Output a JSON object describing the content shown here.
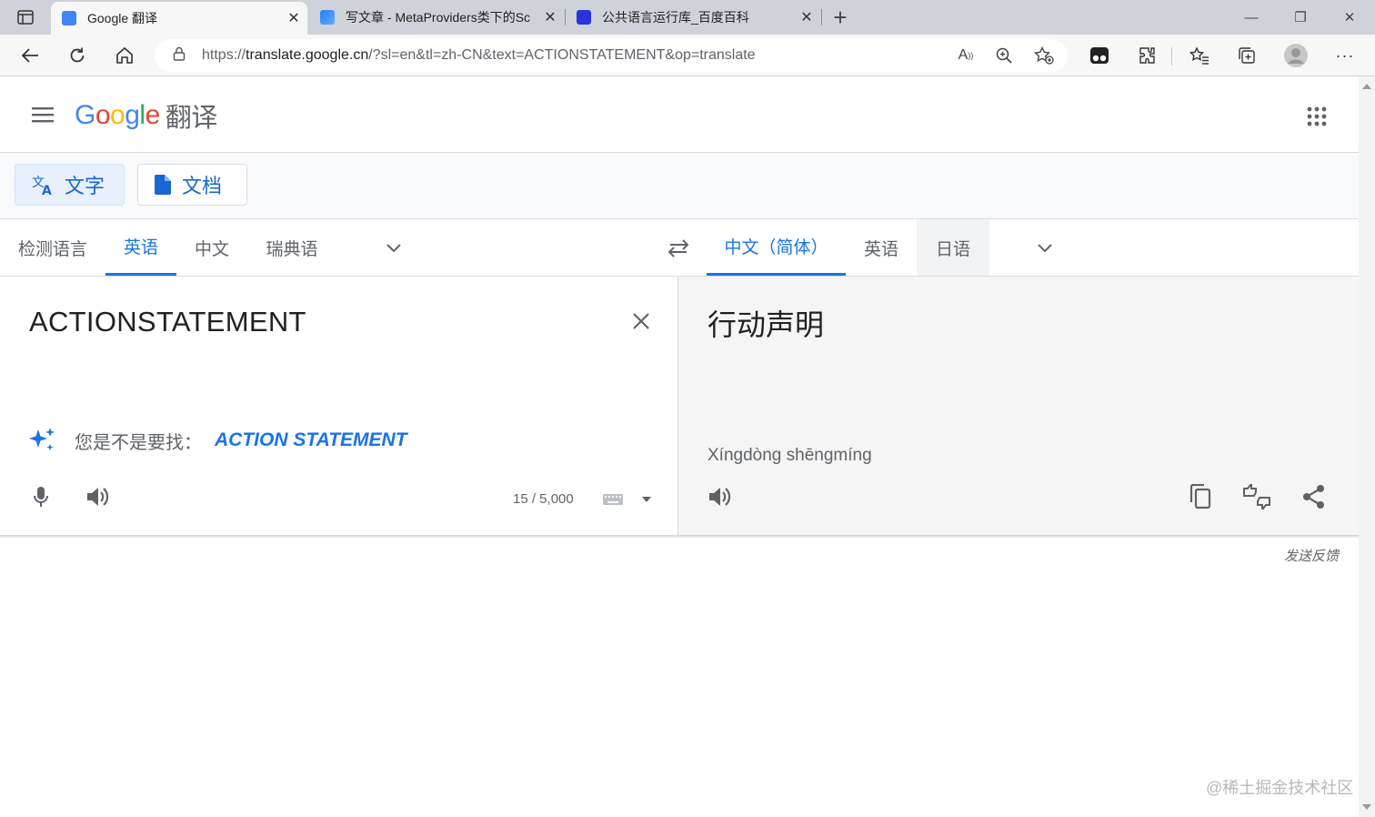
{
  "browser": {
    "tabs": [
      {
        "title": "Google 翻译",
        "active": true
      },
      {
        "title": "写文章 - MetaProviders类下的Sc",
        "active": false
      },
      {
        "title": "公共语言运行库_百度百科",
        "active": false
      }
    ],
    "new_tab": "+",
    "url_prefix": "https://",
    "url_host": "translate.google.cn",
    "url_rest": "/?sl=en&tl=zh-CN&text=ACTIONSTATEMENT&op=translate",
    "window_controls": {
      "minimize": "—",
      "restore": "❐",
      "close": "✕"
    }
  },
  "header": {
    "logo": [
      "G",
      "o",
      "o",
      "g",
      "l",
      "e"
    ],
    "product": "翻译"
  },
  "modes": {
    "text": "文字",
    "document": "文档"
  },
  "source_langs": [
    "检测语言",
    "英语",
    "中文",
    "瑞典语"
  ],
  "target_langs": [
    "中文（简体）",
    "英语",
    "日语"
  ],
  "source": {
    "text": "ACTIONSTATEMENT",
    "did_you_mean_label": "您是不是要找：",
    "suggestion": "ACTION STATEMENT",
    "char_count": "15 / 5,000"
  },
  "target": {
    "text": "行动声明",
    "romanization": "Xíngdòng shēngmíng"
  },
  "footer": {
    "feedback": "发送反馈",
    "watermark": "@稀土掘金技术社区"
  },
  "colors": {
    "accent": "#1a73e8",
    "tab_bar": "#cfd3d9",
    "target_pane": "#f5f5f5"
  }
}
